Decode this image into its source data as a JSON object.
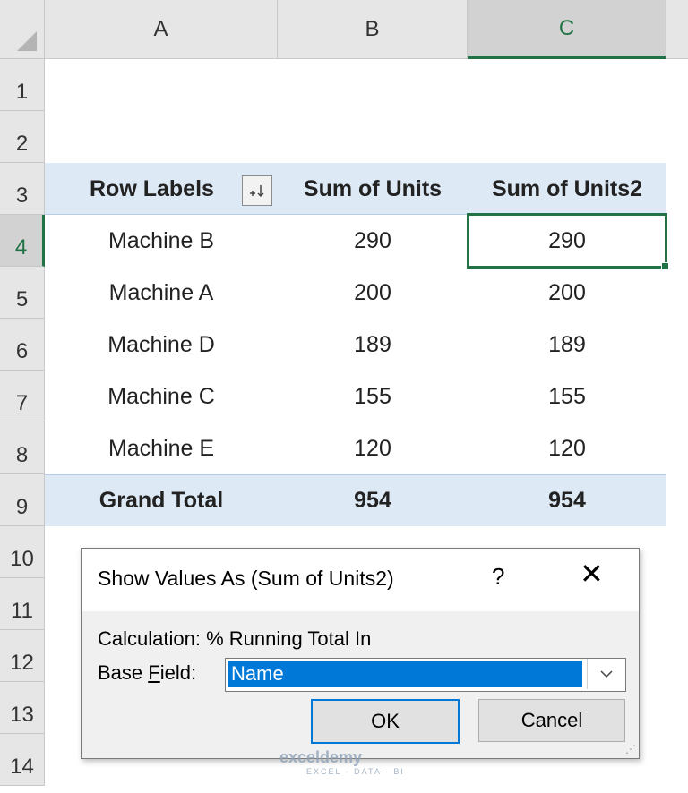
{
  "sheet": {
    "columns": [
      "A",
      "B",
      "C"
    ],
    "rows": [
      "1",
      "2",
      "3",
      "4",
      "5",
      "6",
      "7",
      "8",
      "9",
      "10",
      "11",
      "12",
      "13",
      "14"
    ],
    "selected_column": "C",
    "selected_row": "4"
  },
  "pivot": {
    "header": {
      "row_labels": "Row Labels",
      "col_b": "Sum of Units",
      "col_c": "Sum of Units2",
      "filter_icon": "sort-descending-filter-icon"
    },
    "rows": [
      {
        "label": "Machine B",
        "b": "290",
        "c": "290"
      },
      {
        "label": "Machine A",
        "b": "200",
        "c": "200"
      },
      {
        "label": "Machine D",
        "b": "189",
        "c": "189"
      },
      {
        "label": "Machine C",
        "b": "155",
        "c": "155"
      },
      {
        "label": "Machine E",
        "b": "120",
        "c": "120"
      }
    ],
    "total": {
      "label": "Grand Total",
      "b": "954",
      "c": "954"
    }
  },
  "dialog": {
    "title": "Show Values As (Sum of Units2)",
    "help": "?",
    "close": "✕",
    "calculation": "Calculation: % Running Total In",
    "base_field_label_pre": "Base ",
    "base_field_label_ul": "F",
    "base_field_label_post": "ield:",
    "base_field_value": "Name",
    "ok": "OK",
    "cancel": "Cancel"
  },
  "watermark": {
    "name": "exceldemy",
    "tagline": "EXCEL · DATA · BI"
  },
  "colors": {
    "accent": "#217346",
    "pivot_band": "#dde9f5",
    "selection": "#0078d7"
  }
}
